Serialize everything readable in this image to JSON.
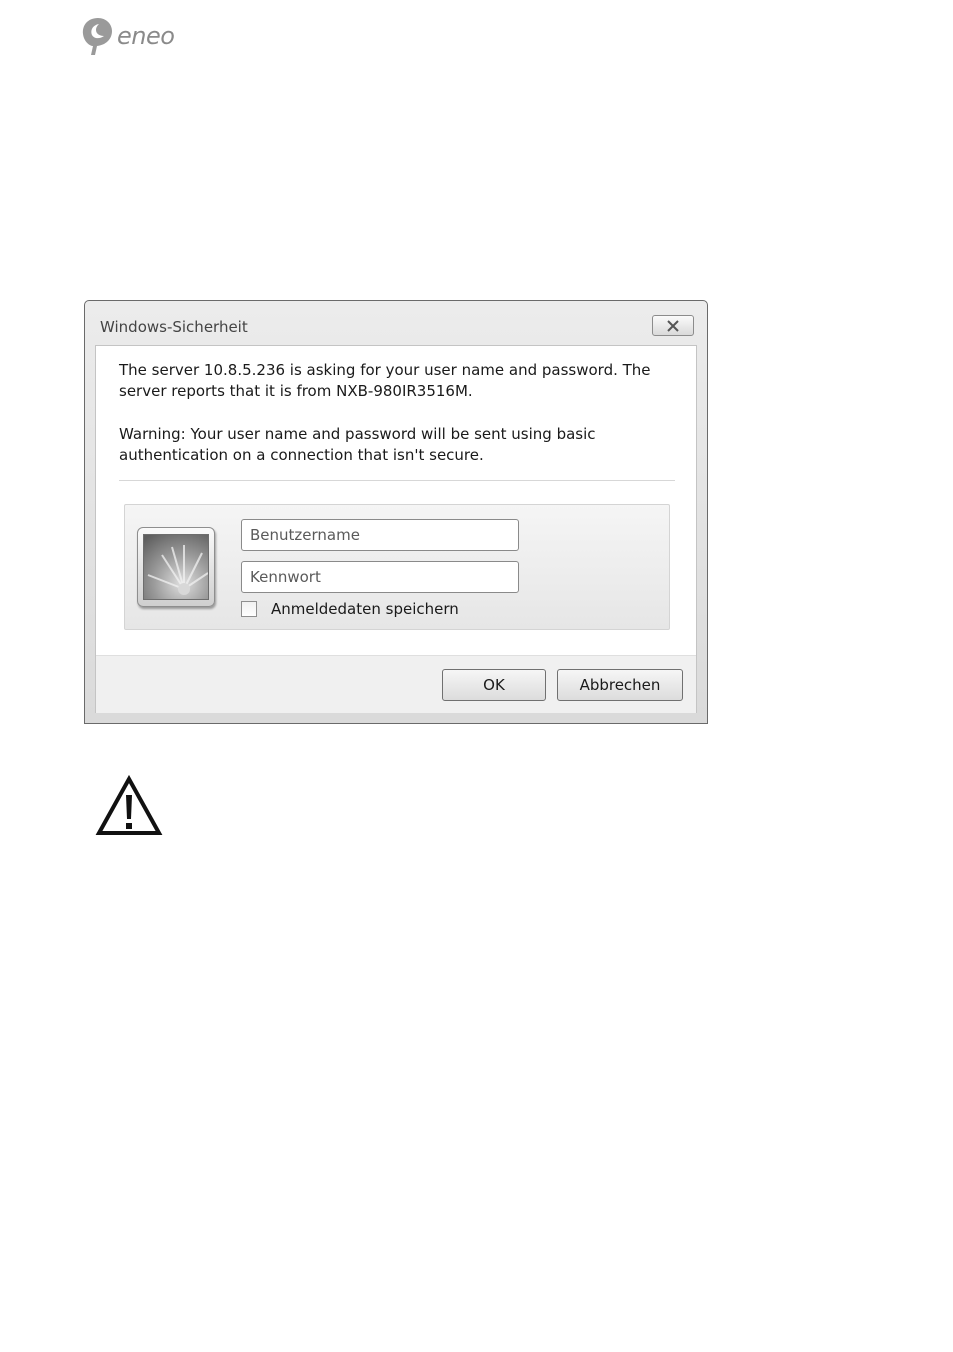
{
  "brand": {
    "logo_text": "eneo",
    "logo_icon": "eneo-logo-icon"
  },
  "dialog": {
    "title": "Windows-Sicherheit",
    "close_icon": "close-icon",
    "message": "The server 10.8.5.236 is asking for your user name and password. The server reports that it is from NXB-980IR3516M.",
    "warning": "Warning: Your user name and password will be sent using basic authentication on a connection that isn't secure.",
    "credentials": {
      "avatar_icon": "user-tile-flower-icon",
      "username_placeholder": "Benutzername",
      "username_value": "",
      "password_placeholder": "Kennwort",
      "password_value": "",
      "remember_label": "Anmeldedaten speichern",
      "remember_checked": false
    },
    "buttons": {
      "ok": "OK",
      "cancel": "Abbrechen"
    }
  },
  "page": {
    "warning_icon": "warning-triangle-icon"
  }
}
